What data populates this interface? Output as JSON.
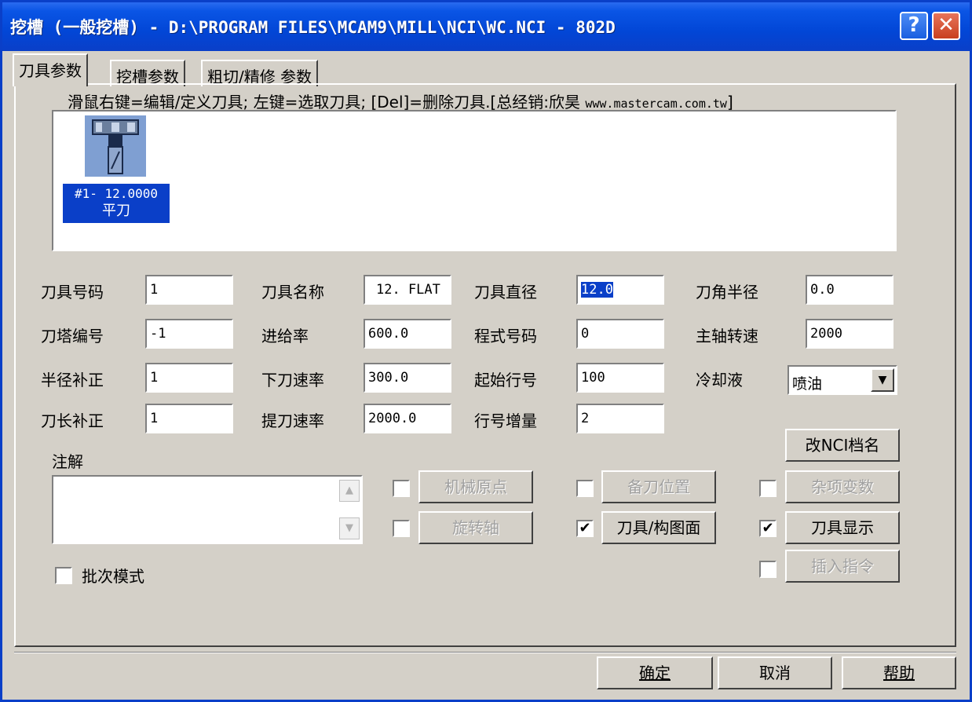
{
  "window": {
    "title": "挖槽 (一般挖槽) - D:\\PROGRAM FILES\\MCAM9\\MILL\\NCI\\WC.NCI - 802D",
    "help_btn": "?",
    "close_btn": "✕"
  },
  "tabs": [
    "刀具参数",
    "挖槽参数",
    "粗切/精修 参数"
  ],
  "hint": {
    "text": "滑鼠右键=编辑/定义刀具; 左键=选取刀具; [Del]=删除刀具.[总经销:欣昊 ",
    "url": "www.mastercam.com.tw",
    "close": "]"
  },
  "tool": {
    "number_text": "#1- 12.0000",
    "type": "平刀"
  },
  "fields": {
    "tool_number": {
      "label": "刀具号码",
      "value": "1"
    },
    "tool_name": {
      "label": "刀具名称",
      "value": "12. FLAT"
    },
    "tool_diameter": {
      "label": "刀具直径",
      "value": "12.0"
    },
    "corner_radius": {
      "label": "刀角半径",
      "value": "0.0"
    },
    "turret_number": {
      "label": "刀塔编号",
      "value": "-1"
    },
    "feed_rate": {
      "label": "进给率",
      "value": "600.0"
    },
    "program_number": {
      "label": "程式号码",
      "value": "0"
    },
    "spindle_speed": {
      "label": "主轴转速",
      "value": "2000"
    },
    "dia_offset": {
      "label": "半径补正",
      "value": "1"
    },
    "plunge_rate": {
      "label": "下刀速率",
      "value": "300.0"
    },
    "start_seq": {
      "label": "起始行号",
      "value": "100"
    },
    "coolant": {
      "label": "冷却液",
      "value": "喷油"
    },
    "len_offset": {
      "label": "刀长补正",
      "value": "1"
    },
    "retract_rate": {
      "label": "提刀速率",
      "value": "2000.0"
    },
    "seq_increment": {
      "label": "行号增量",
      "value": "2"
    }
  },
  "comment_label": "注解",
  "buttons": {
    "rename_nci": "改NCI档名",
    "home_pos": "机械原点",
    "ref_point": "备刀位置",
    "misc_values": "杂项变数",
    "rotary_axis": "旋转轴",
    "tool_plane": "刀具/构图面",
    "tool_display": "刀具显示",
    "canned_text": "插入指令",
    "ok": "确定",
    "cancel": "取消",
    "help": "帮助"
  },
  "checks": {
    "home_pos": false,
    "ref_point": false,
    "misc_values": false,
    "rotary_axis": false,
    "tool_plane": true,
    "tool_display": true,
    "canned_text": false,
    "batch_mode": false
  },
  "batch_label": "批次模式",
  "check_glyph": "✔"
}
